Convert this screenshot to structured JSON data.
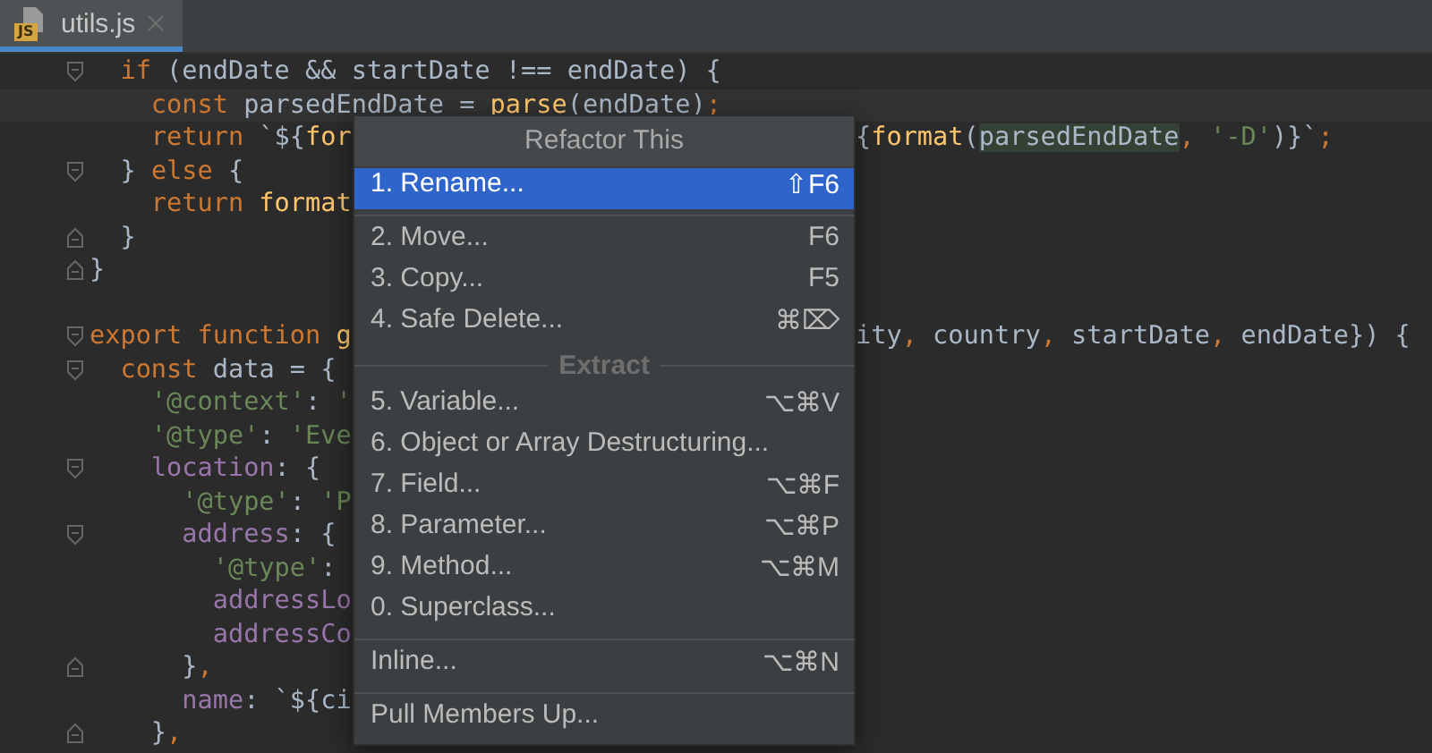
{
  "tabs": [
    {
      "label": "utils.js",
      "icon_text": "JS",
      "selected": true
    }
  ],
  "code_lines": [
    {
      "kind": "opener",
      "tokens": [
        {
          "kind": "keyword",
          "text": "  if"
        },
        {
          "kind": "ident",
          "text": " (endDate && startDate !== endDate) {"
        }
      ]
    },
    {
      "kind": "plain",
      "current": true,
      "tokens": [
        {
          "kind": "keyword",
          "text": "    const"
        },
        {
          "kind": "ident",
          "text": " parsedEndDate = "
        },
        {
          "kind": "function",
          "text": "parse"
        },
        {
          "kind": "ident",
          "text": "(endDate)"
        },
        {
          "kind": "punct",
          "text": ";"
        }
      ]
    },
    {
      "kind": "plain",
      "tokens": [
        {
          "kind": "keyword",
          "text": "    return"
        },
        {
          "kind": "ident",
          "text": " `${"
        },
        {
          "kind": "function",
          "text": "for"
        }
      ],
      "right": [
        {
          "kind": "ident",
          "text": "{"
        },
        {
          "kind": "function",
          "text": "format"
        },
        {
          "kind": "ident",
          "text": "("
        },
        {
          "kind": "usage",
          "text": "parsedEndDate"
        },
        {
          "kind": "punct",
          "text": ","
        },
        {
          "kind": "string",
          "text": " '-D'"
        },
        {
          "kind": "ident",
          "text": ")}`"
        },
        {
          "kind": "punct",
          "text": ";"
        }
      ]
    },
    {
      "kind": "opener",
      "tokens": [
        {
          "kind": "ident",
          "text": "  } "
        },
        {
          "kind": "keyword",
          "text": "else"
        },
        {
          "kind": "ident",
          "text": " {"
        }
      ]
    },
    {
      "kind": "plain",
      "tokens": [
        {
          "kind": "keyword",
          "text": "    return"
        },
        {
          "kind": "function",
          "text": " format"
        }
      ]
    },
    {
      "kind": "closer",
      "tokens": [
        {
          "kind": "ident",
          "text": "  }"
        }
      ]
    },
    {
      "kind": "closer",
      "tokens": [
        {
          "kind": "ident",
          "text": "}"
        }
      ]
    },
    {
      "kind": "plain"
    },
    {
      "kind": "opener",
      "tokens": [
        {
          "kind": "keyword",
          "text": "export function"
        },
        {
          "kind": "function",
          "text": " g"
        }
      ],
      "right": [
        {
          "kind": "ident",
          "text": "ity"
        },
        {
          "kind": "punct",
          "text": ","
        },
        {
          "kind": "ident",
          "text": " country"
        },
        {
          "kind": "punct",
          "text": ","
        },
        {
          "kind": "ident",
          "text": " startDate"
        },
        {
          "kind": "punct",
          "text": ","
        },
        {
          "kind": "ident",
          "text": " endDate}) {"
        }
      ]
    },
    {
      "kind": "opener",
      "tokens": [
        {
          "kind": "keyword",
          "text": "  const"
        },
        {
          "kind": "ident",
          "text": " data = {"
        }
      ]
    },
    {
      "kind": "plain",
      "tokens": [
        {
          "kind": "string",
          "text": "    '@context'"
        },
        {
          "kind": "ident",
          "text": ": "
        },
        {
          "kind": "string",
          "text": "'"
        }
      ]
    },
    {
      "kind": "plain",
      "tokens": [
        {
          "kind": "string",
          "text": "    '@type'"
        },
        {
          "kind": "ident",
          "text": ": "
        },
        {
          "kind": "string",
          "text": "'Eve"
        }
      ]
    },
    {
      "kind": "opener",
      "tokens": [
        {
          "kind": "property",
          "text": "    location"
        },
        {
          "kind": "ident",
          "text": ": {"
        }
      ]
    },
    {
      "kind": "plain",
      "tokens": [
        {
          "kind": "string",
          "text": "      '@type'"
        },
        {
          "kind": "ident",
          "text": ": "
        },
        {
          "kind": "string",
          "text": "'P"
        }
      ]
    },
    {
      "kind": "opener",
      "tokens": [
        {
          "kind": "property",
          "text": "      address"
        },
        {
          "kind": "ident",
          "text": ": {"
        }
      ]
    },
    {
      "kind": "plain",
      "tokens": [
        {
          "kind": "string",
          "text": "        '@type'"
        },
        {
          "kind": "ident",
          "text": ":"
        }
      ]
    },
    {
      "kind": "plain",
      "tokens": [
        {
          "kind": "property",
          "text": "        addressLo"
        }
      ]
    },
    {
      "kind": "plain",
      "tokens": [
        {
          "kind": "property",
          "text": "        addressCo"
        }
      ]
    },
    {
      "kind": "closer",
      "tokens": [
        {
          "kind": "ident",
          "text": "      }"
        },
        {
          "kind": "punct",
          "text": ","
        }
      ]
    },
    {
      "kind": "plain",
      "tokens": [
        {
          "kind": "property",
          "text": "      name"
        },
        {
          "kind": "ident",
          "text": ": `${ci"
        }
      ]
    },
    {
      "kind": "closer",
      "tokens": [
        {
          "kind": "ident",
          "text": "    }"
        },
        {
          "kind": "punct",
          "text": ","
        }
      ]
    }
  ],
  "popup": {
    "title": "Refactor This",
    "items": [
      {
        "kind": "item",
        "label": "1. Rename...",
        "shortcut": "⇧F6",
        "selected": true
      },
      {
        "kind": "separator"
      },
      {
        "kind": "item",
        "label": "2. Move...",
        "shortcut": "F6",
        "selected": false
      },
      {
        "kind": "item",
        "label": "3. Copy...",
        "shortcut": "F5",
        "selected": false
      },
      {
        "kind": "item",
        "label": "4. Safe Delete...",
        "shortcut": "⌘⌦",
        "selected": false
      },
      {
        "kind": "group",
        "label": "Extract"
      },
      {
        "kind": "item",
        "label": "5. Variable...",
        "shortcut": "⌥⌘V",
        "selected": false
      },
      {
        "kind": "item",
        "label": "6. Object or Array Destructuring...",
        "selected": false
      },
      {
        "kind": "item",
        "label": "7. Field...",
        "shortcut": "⌥⌘F",
        "selected": false
      },
      {
        "kind": "item",
        "label": "8. Parameter...",
        "shortcut": "⌥⌘P",
        "selected": false
      },
      {
        "kind": "item",
        "label": "9. Method...",
        "shortcut": "⌥⌘M",
        "selected": false
      },
      {
        "kind": "item",
        "label": "0. Superclass...",
        "selected": false
      },
      {
        "kind": "separator"
      },
      {
        "kind": "item",
        "label": "Inline...",
        "shortcut": "⌥⌘N",
        "selected": false
      },
      {
        "kind": "separator"
      },
      {
        "kind": "item",
        "label": "Pull Members Up...",
        "selected": false
      }
    ]
  }
}
